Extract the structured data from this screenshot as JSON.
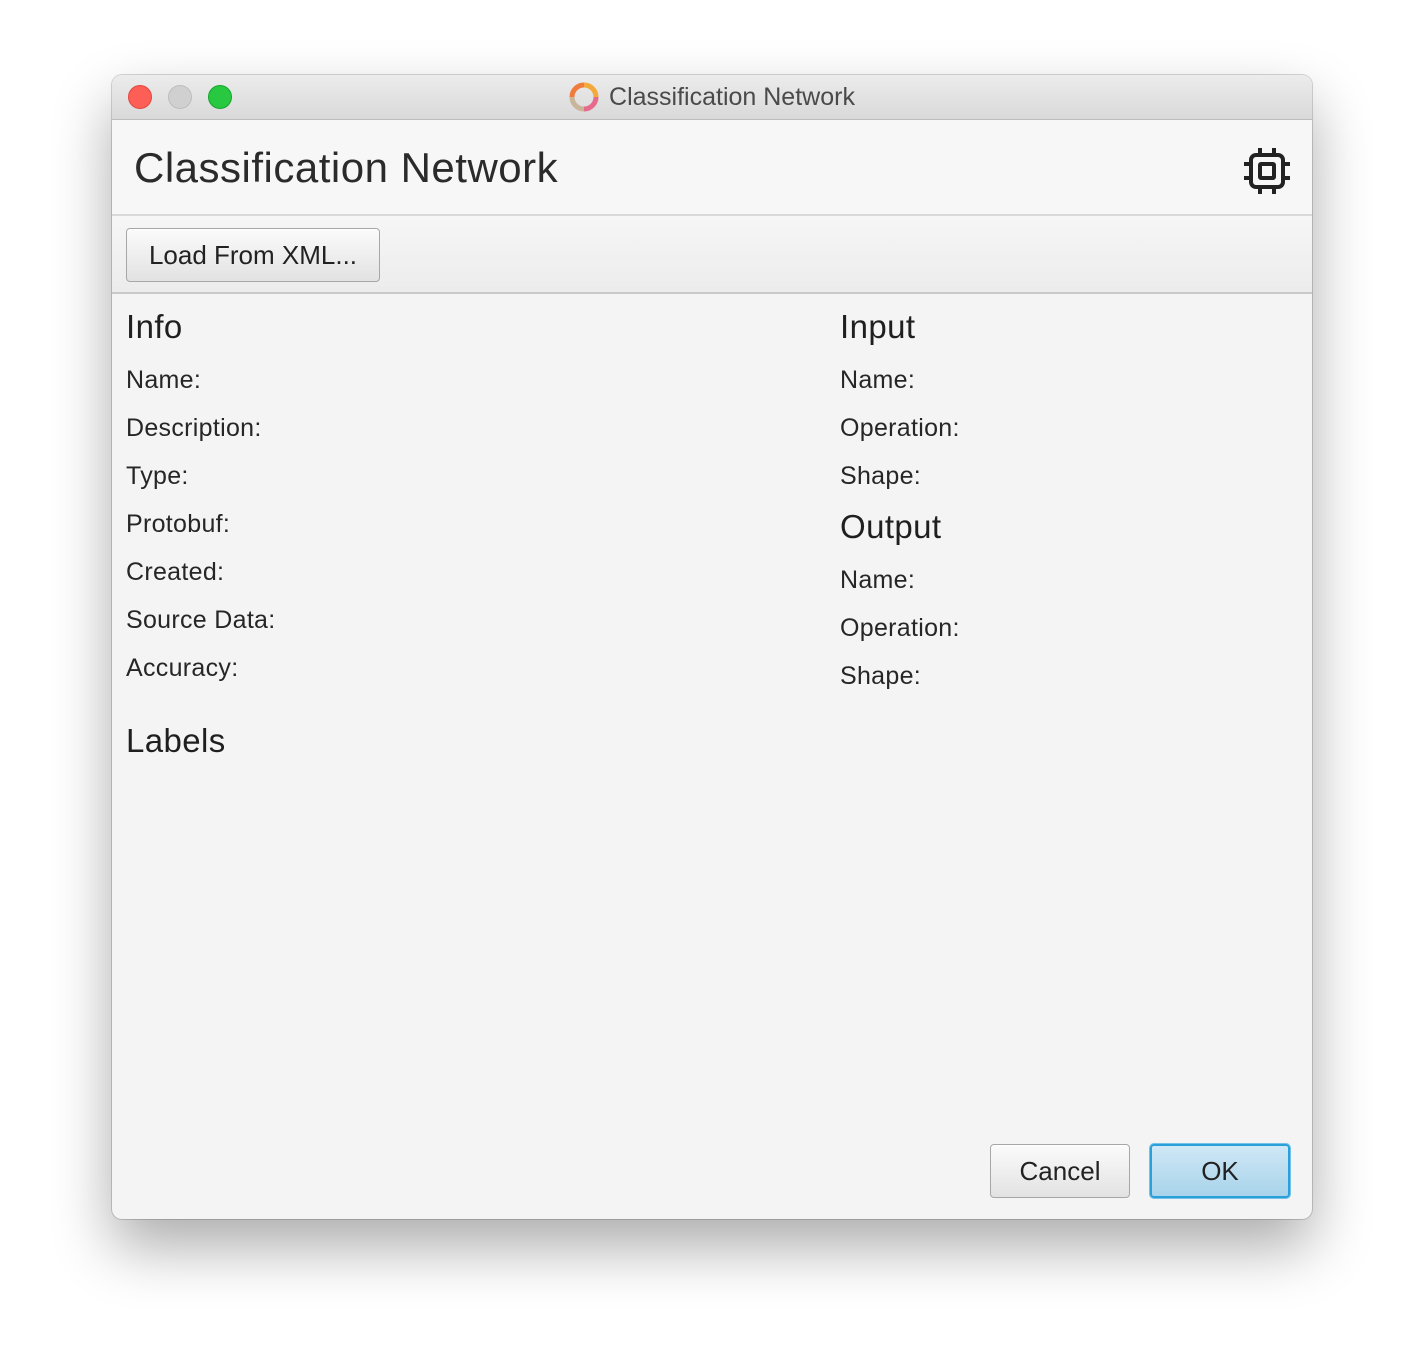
{
  "window": {
    "title": "Classification Network"
  },
  "header": {
    "title": "Classification Network",
    "icon": "chip-icon"
  },
  "toolbar": {
    "load_label": "Load From XML..."
  },
  "info": {
    "title": "Info",
    "fields": [
      "Name:",
      "Description:",
      "Type:",
      "Protobuf:",
      "Created:",
      "Source Data:",
      "Accuracy:"
    ]
  },
  "input": {
    "title": "Input",
    "fields": [
      "Name:",
      "Operation:",
      "Shape:"
    ]
  },
  "output": {
    "title": "Output",
    "fields": [
      "Name:",
      "Operation:",
      "Shape:"
    ]
  },
  "labels": {
    "title": "Labels"
  },
  "footer": {
    "cancel_label": "Cancel",
    "ok_label": "OK"
  },
  "colors": {
    "close": "#fd5f57",
    "minimize": "#d0d0d0",
    "zoom": "#28c840",
    "ok_accent": "#2aa0d8"
  }
}
